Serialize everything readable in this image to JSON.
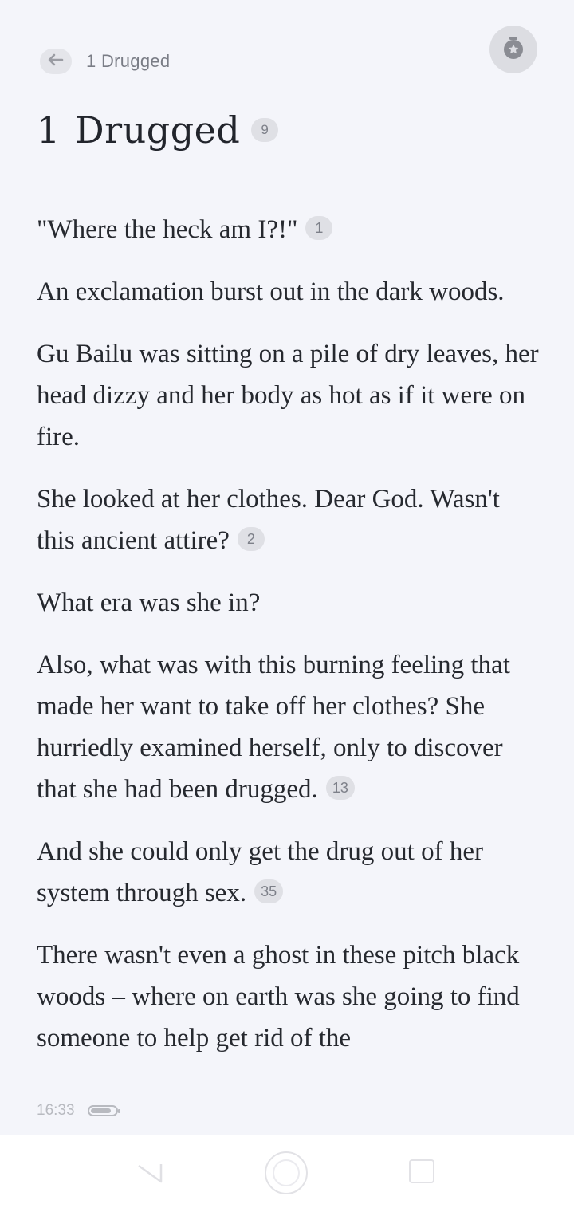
{
  "header": {
    "back_icon": "arrow-left-icon",
    "breadcrumb": "1  Drugged",
    "award_icon": "medal-star-icon"
  },
  "chapter": {
    "number": "1",
    "name": "Drugged",
    "comment_count": "9"
  },
  "paragraphs": [
    {
      "text": "\"Where the heck am I?!\"",
      "comments": "1"
    },
    {
      "text": "An exclamation burst out in the dark woods.",
      "comments": null
    },
    {
      "text": "Gu Bailu was sitting on a pile of dry leaves, her head dizzy and her body as hot as if it were on fire.",
      "comments": null
    },
    {
      "text": "She looked at her clothes. Dear God. Wasn't this ancient attire?",
      "comments": "2"
    },
    {
      "text": "What era was she in?",
      "comments": null
    },
    {
      "text": "Also, what was with this burning feeling that made her want to take off her clothes? She hurriedly examined herself, only to discover that she had been drugged.",
      "comments": "13"
    },
    {
      "text": "And she could only get the drug out of her system through sex.",
      "comments": "35"
    },
    {
      "text": "There wasn't even a ghost in these pitch black woods – where on earth was she going to find someone to help get rid of the",
      "comments": null
    }
  ],
  "status": {
    "time": "16:33",
    "battery_level": 0.85
  },
  "nav": {
    "back_icon": "nav-back-triangle-icon",
    "home_icon": "nav-home-circle-icon",
    "recent_icon": "nav-recent-square-icon"
  },
  "colors": {
    "background": "#f4f5fa",
    "text": "#26292f",
    "badge_bg": "#dfe0e5",
    "badge_text": "#7d8089"
  }
}
